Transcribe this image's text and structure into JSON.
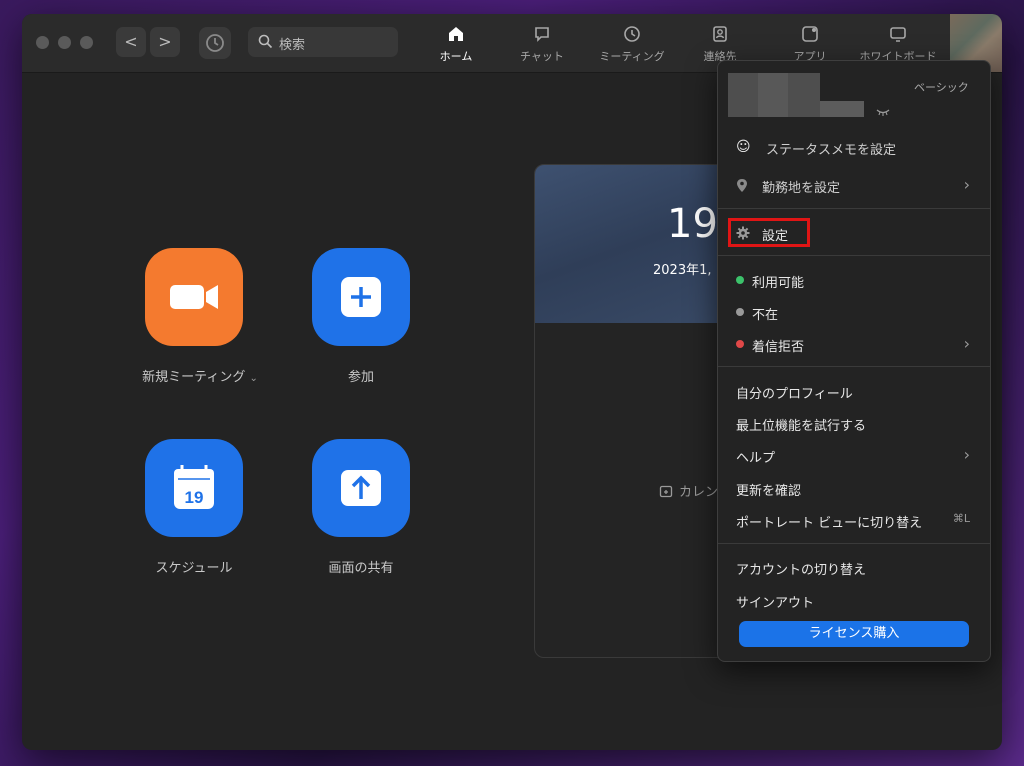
{
  "toolbar": {
    "back_label": "<",
    "forward_label": ">",
    "search_placeholder": "検索"
  },
  "tabs": [
    {
      "label": "ホーム",
      "icon": "home-icon"
    },
    {
      "label": "チャット",
      "icon": "chat-icon"
    },
    {
      "label": "ミーティング",
      "icon": "clock-icon"
    },
    {
      "label": "連絡先",
      "icon": "contacts-icon"
    },
    {
      "label": "アプリ",
      "icon": "apps-icon"
    },
    {
      "label": "ホワイトボード",
      "icon": "whiteboard-icon"
    }
  ],
  "actions": [
    {
      "label": "新規ミーティング",
      "icon": "video-camera-icon",
      "color": "#f47a2f"
    },
    {
      "label": "参加",
      "icon": "plus-icon",
      "color": "#1f72e8"
    },
    {
      "label": "スケジュール",
      "icon": "calendar-icon",
      "icon_text": "19",
      "color": "#1f72e8"
    },
    {
      "label": "画面の共有",
      "icon": "share-screen-icon",
      "color": "#1f72e8"
    }
  ],
  "calendar": {
    "time": "19",
    "date": "2023年1,",
    "empty_text": "カレン"
  },
  "profile_menu": {
    "plan": "ベーシック",
    "status_memo": "ステータスメモを設定",
    "work_location": "勤務地を設定",
    "settings": "設定",
    "statuses": [
      {
        "label": "利用可能",
        "color": "#3cc26b"
      },
      {
        "label": "不在",
        "color": "#9a9a9a"
      },
      {
        "label": "着信拒否",
        "color": "#e04848"
      }
    ],
    "my_profile": "自分のプロフィール",
    "try_top_features": "最上位機能を試行する",
    "help": "ヘルプ",
    "check_updates": "更新を確認",
    "portrait_view": "ポートレート ビューに切り替え",
    "portrait_shortcut": "⌘L",
    "switch_account": "アカウントの切り替え",
    "sign_out": "サインアウト",
    "buy_license": "ライセンス購入"
  }
}
